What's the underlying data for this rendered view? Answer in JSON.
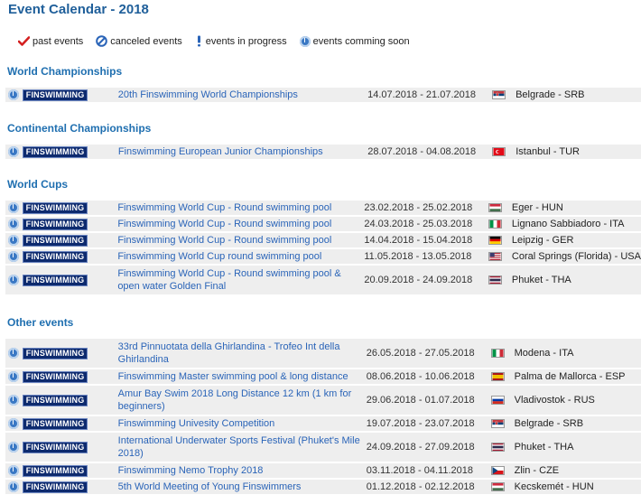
{
  "page": {
    "title": "Event Calendar - 2018"
  },
  "legend": {
    "past": "past events",
    "canceled": "canceled events",
    "progress": "events in progress",
    "soon": "events comming soon"
  },
  "sections": [
    {
      "title": "World Championships",
      "events": [
        {
          "discipline": "FINSWIMMING",
          "name": "20th Finswimming World Championships",
          "dates": "14.07.2018 - 21.07.2018",
          "flag": "SRB",
          "location": "Belgrade - SRB"
        }
      ]
    },
    {
      "title": "Continental Championships",
      "events": [
        {
          "discipline": "FINSWIMMING",
          "name": "Finswimming European Junior Championships",
          "dates": "28.07.2018 - 04.08.2018",
          "flag": "TUR",
          "location": "Istanbul - TUR"
        }
      ]
    },
    {
      "title": "World Cups",
      "events": [
        {
          "discipline": "FINSWIMMING",
          "name": "Finswimming World Cup - Round swimming pool",
          "dates": "23.02.2018 - 25.02.2018",
          "flag": "HUN",
          "location": "Eger - HUN"
        },
        {
          "discipline": "FINSWIMMING",
          "name": "Finswimming World Cup - Round swimming pool",
          "dates": "24.03.2018 - 25.03.2018",
          "flag": "ITA",
          "location": "Lignano Sabbiadoro - ITA"
        },
        {
          "discipline": "FINSWIMMING",
          "name": "Finswimming World Cup - Round swimming pool",
          "dates": "14.04.2018 - 15.04.2018",
          "flag": "GER",
          "location": "Leipzig - GER"
        },
        {
          "discipline": "FINSWIMMING",
          "name": "Finswimming World Cup round swimming pool",
          "dates": "11.05.2018 - 13.05.2018",
          "flag": "USA",
          "location": "Coral Springs (Florida) - USA"
        },
        {
          "discipline": "FINSWIMMING",
          "name": "Finswimming World Cup - Round swimming pool & open water Golden Final",
          "dates": "20.09.2018 - 24.09.2018",
          "flag": "THA",
          "location": "Phuket - THA"
        }
      ]
    },
    {
      "title": "Other events",
      "events": [
        {
          "discipline": "FINSWIMMING",
          "name": "33rd Pinnuotata della Ghirlandina - Trofeo Int della Ghirlandina",
          "dates": "26.05.2018 - 27.05.2018",
          "flag": "ITA",
          "location": "Modena - ITA"
        },
        {
          "discipline": "FINSWIMMING",
          "name": "Finswimming Master swimming pool & long distance",
          "dates": "08.06.2018 - 10.06.2018",
          "flag": "ESP",
          "location": "Palma de Mallorca - ESP"
        },
        {
          "discipline": "FINSWIMMING",
          "name": "Amur Bay Swim 2018 Long Distance 12 km (1 km for beginners)",
          "dates": "29.06.2018 - 01.07.2018",
          "flag": "RUS",
          "location": "Vladivostok - RUS"
        },
        {
          "discipline": "FINSWIMMING",
          "name": "Finswimming Univesity Competition",
          "dates": "19.07.2018 - 23.07.2018",
          "flag": "SRB",
          "location": "Belgrade - SRB"
        },
        {
          "discipline": "FINSWIMMING",
          "name": "International Underwater Sports Festival (Phuket's Mile 2018)",
          "dates": "24.09.2018 - 27.09.2018",
          "flag": "THA",
          "location": "Phuket - THA"
        },
        {
          "discipline": "FINSWIMMING",
          "name": "Finswimming Nemo Trophy 2018",
          "dates": "03.11.2018 - 04.11.2018",
          "flag": "CZE",
          "location": "Zlin - CZE"
        },
        {
          "discipline": "FINSWIMMING",
          "name": "5th World Meeting of Young Finswimmers",
          "dates": "01.12.2018 - 02.12.2018",
          "flag": "HUN",
          "location": "Kecskemét - HUN"
        }
      ]
    }
  ]
}
